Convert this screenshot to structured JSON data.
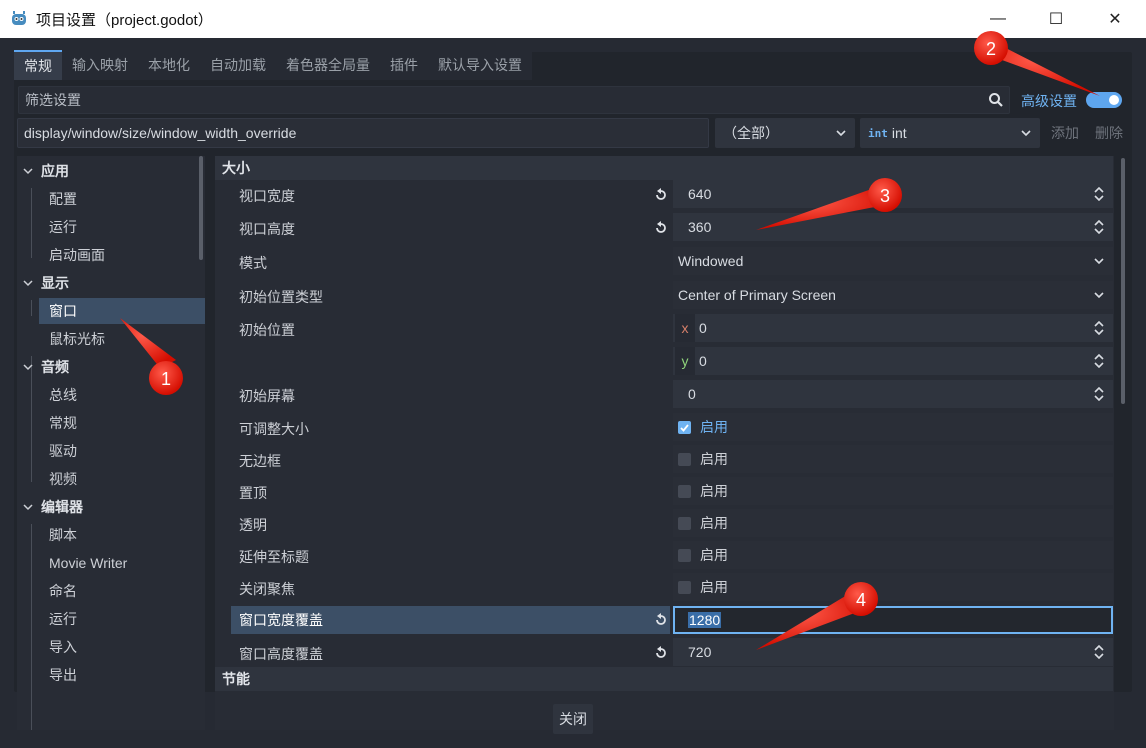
{
  "window": {
    "title": "项目设置（project.godot）",
    "minimize": "—",
    "maximize": "☐",
    "close": "✕"
  },
  "tabs": [
    "常规",
    "输入映射",
    "本地化",
    "自动加载",
    "着色器全局量",
    "插件",
    "默认导入设置"
  ],
  "filter": {
    "placeholder": "筛选设置",
    "advanced_label": "高级设置",
    "advanced_on": true
  },
  "path_row": {
    "path": "display/window/size/window_width_override",
    "scope": "（全部）",
    "type_badge": "int",
    "type": "int",
    "add": "添加",
    "delete": "删除"
  },
  "tree": {
    "app": "应用",
    "app_items": [
      "配置",
      "运行",
      "启动画面"
    ],
    "display": "显示",
    "display_items": [
      "窗口",
      "鼠标光标"
    ],
    "audio": "音频",
    "audio_items": [
      "总线",
      "常规",
      "驱动",
      "视频"
    ],
    "editor": "编辑器",
    "editor_items": [
      "脚本",
      "Movie Writer",
      "命名",
      "运行",
      "导入",
      "导出"
    ]
  },
  "settings": {
    "section_size": "大小",
    "section_energy": "节能",
    "viewport_width": {
      "label": "视口宽度",
      "value": "640"
    },
    "viewport_height": {
      "label": "视口高度",
      "value": "360"
    },
    "mode": {
      "label": "模式",
      "value": "Windowed"
    },
    "initial_position_type": {
      "label": "初始位置类型",
      "value": "Center of Primary Screen"
    },
    "initial_position": {
      "label": "初始位置",
      "x_tag": "x",
      "x": "0",
      "y_tag": "y",
      "y": "0"
    },
    "initial_screen": {
      "label": "初始屏幕",
      "value": "0"
    },
    "resizable": {
      "label": "可调整大小",
      "check": "启用",
      "on": true
    },
    "borderless": {
      "label": "无边框",
      "check": "启用",
      "on": false
    },
    "always_on_top": {
      "label": "置顶",
      "check": "启用",
      "on": false
    },
    "transparent": {
      "label": "透明",
      "check": "启用",
      "on": false
    },
    "extend_to_title": {
      "label": "延伸至标题",
      "check": "启用",
      "on": false
    },
    "no_focus": {
      "label": "关闭聚焦",
      "check": "启用",
      "on": false
    },
    "width_override": {
      "label": "窗口宽度覆盖",
      "value": "1280"
    },
    "height_override": {
      "label": "窗口高度覆盖",
      "value": "720"
    }
  },
  "footer": {
    "close": "关闭"
  },
  "annotations": [
    "1",
    "2",
    "3",
    "4"
  ],
  "colors": {
    "accent": "#5fa7f1",
    "selection": "#3c4f66",
    "annotation": "#ff0000"
  }
}
